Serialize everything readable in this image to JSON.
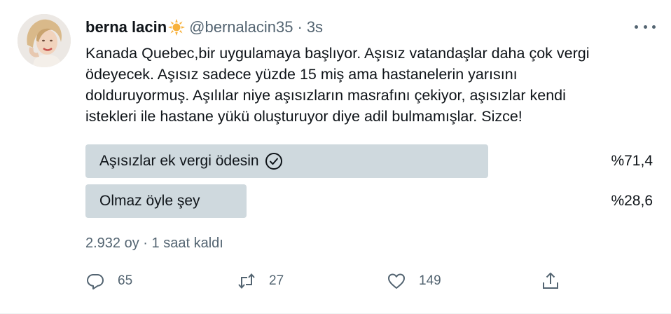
{
  "tweet": {
    "author_name": "berna lacin",
    "handle": "@bernalacin35",
    "separator": "·",
    "time": "3s",
    "text": "Kanada Quebec,bir uygulamaya başlıyor. Aşısız vatandaşlar daha çok vergi\nödeyecek. Aşısız sadece yüzde 15 miş ama hastanelerin yarısını\ndolduruyormuş. Aşılılar niye aşısızların masrafını çekiyor, aşısızlar kendi\nistekleri ile hastane yükü oluşturuyor diye adil bulmamışlar. Sizce!"
  },
  "poll": {
    "options": [
      {
        "label": "Aşısızlar ek vergi ödesin",
        "percent_text": "%71,4",
        "fraction": 0.714,
        "selected": true
      },
      {
        "label": "Olmaz öyle şey",
        "percent_text": "%28,6",
        "fraction": 0.286,
        "selected": false
      }
    ],
    "votes_text": "2.932 oy",
    "separator": "·",
    "remaining_text": "1 saat kaldı"
  },
  "actions": {
    "replies": "65",
    "retweets": "27",
    "likes": "149"
  },
  "icons": {
    "name_emoji": "sun-emoji-icon",
    "more": "more-dots-icon",
    "check": "check-circle-icon",
    "reply": "reply-icon",
    "retweet": "retweet-icon",
    "like": "heart-icon",
    "share": "share-icon"
  },
  "colors": {
    "bar": "#cfd9de",
    "secondary_text": "#536471",
    "primary_text": "#0f1419"
  }
}
